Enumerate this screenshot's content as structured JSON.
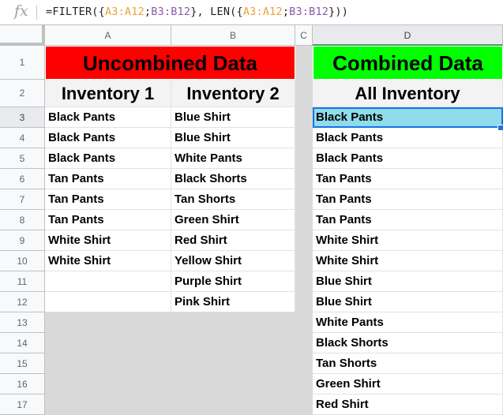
{
  "formula_bar": {
    "fx_icon": "fx-icon",
    "parts": [
      {
        "text": "=FILTER({",
        "cls": ""
      },
      {
        "text": "A3:A12",
        "cls": "r1"
      },
      {
        "text": ";",
        "cls": ""
      },
      {
        "text": "B3:B12",
        "cls": "r2"
      },
      {
        "text": "}, LEN({",
        "cls": ""
      },
      {
        "text": "A3:A12",
        "cls": "r1"
      },
      {
        "text": ";",
        "cls": ""
      },
      {
        "text": "B3:B12",
        "cls": "r2"
      },
      {
        "text": "}))",
        "cls": ""
      }
    ]
  },
  "columns": [
    "A",
    "B",
    "C",
    "D"
  ],
  "selected_column": "D",
  "rows": [
    "1",
    "2",
    "3",
    "4",
    "5",
    "6",
    "7",
    "8",
    "9",
    "10",
    "11",
    "12",
    "13",
    "14",
    "15",
    "16",
    "17"
  ],
  "selected_row": "3",
  "colors": {
    "uncombined_header": "#ff0000",
    "combined_header": "#00ff00",
    "active_cell": "#8fdcea",
    "selection": "#1a73e8"
  },
  "headers": {
    "uncombined": "Uncombined Data",
    "combined": "Combined Data",
    "inventory1": "Inventory 1",
    "inventory2": "Inventory 2",
    "all_inventory": "All Inventory"
  },
  "inventory1": [
    "Black Pants",
    "Black Pants",
    "Black Pants",
    "Tan Pants",
    "Tan Pants",
    "Tan Pants",
    "White Shirt",
    "White Shirt",
    "",
    ""
  ],
  "inventory2": [
    "Blue Shirt",
    "Blue Shirt",
    "White Pants",
    "Black Shorts",
    "Tan Shorts",
    "Green Shirt",
    "Red Shirt",
    "Yellow Shirt",
    "Purple Shirt",
    "Pink Shirt"
  ],
  "all_inventory": [
    "Black Pants",
    "Black Pants",
    "Black Pants",
    "Tan Pants",
    "Tan Pants",
    "Tan Pants",
    "White Shirt",
    "White Shirt",
    "Blue Shirt",
    "Blue Shirt",
    "White Pants",
    "Black Shorts",
    "Tan Shorts",
    "Green Shirt",
    "Red Shirt"
  ]
}
